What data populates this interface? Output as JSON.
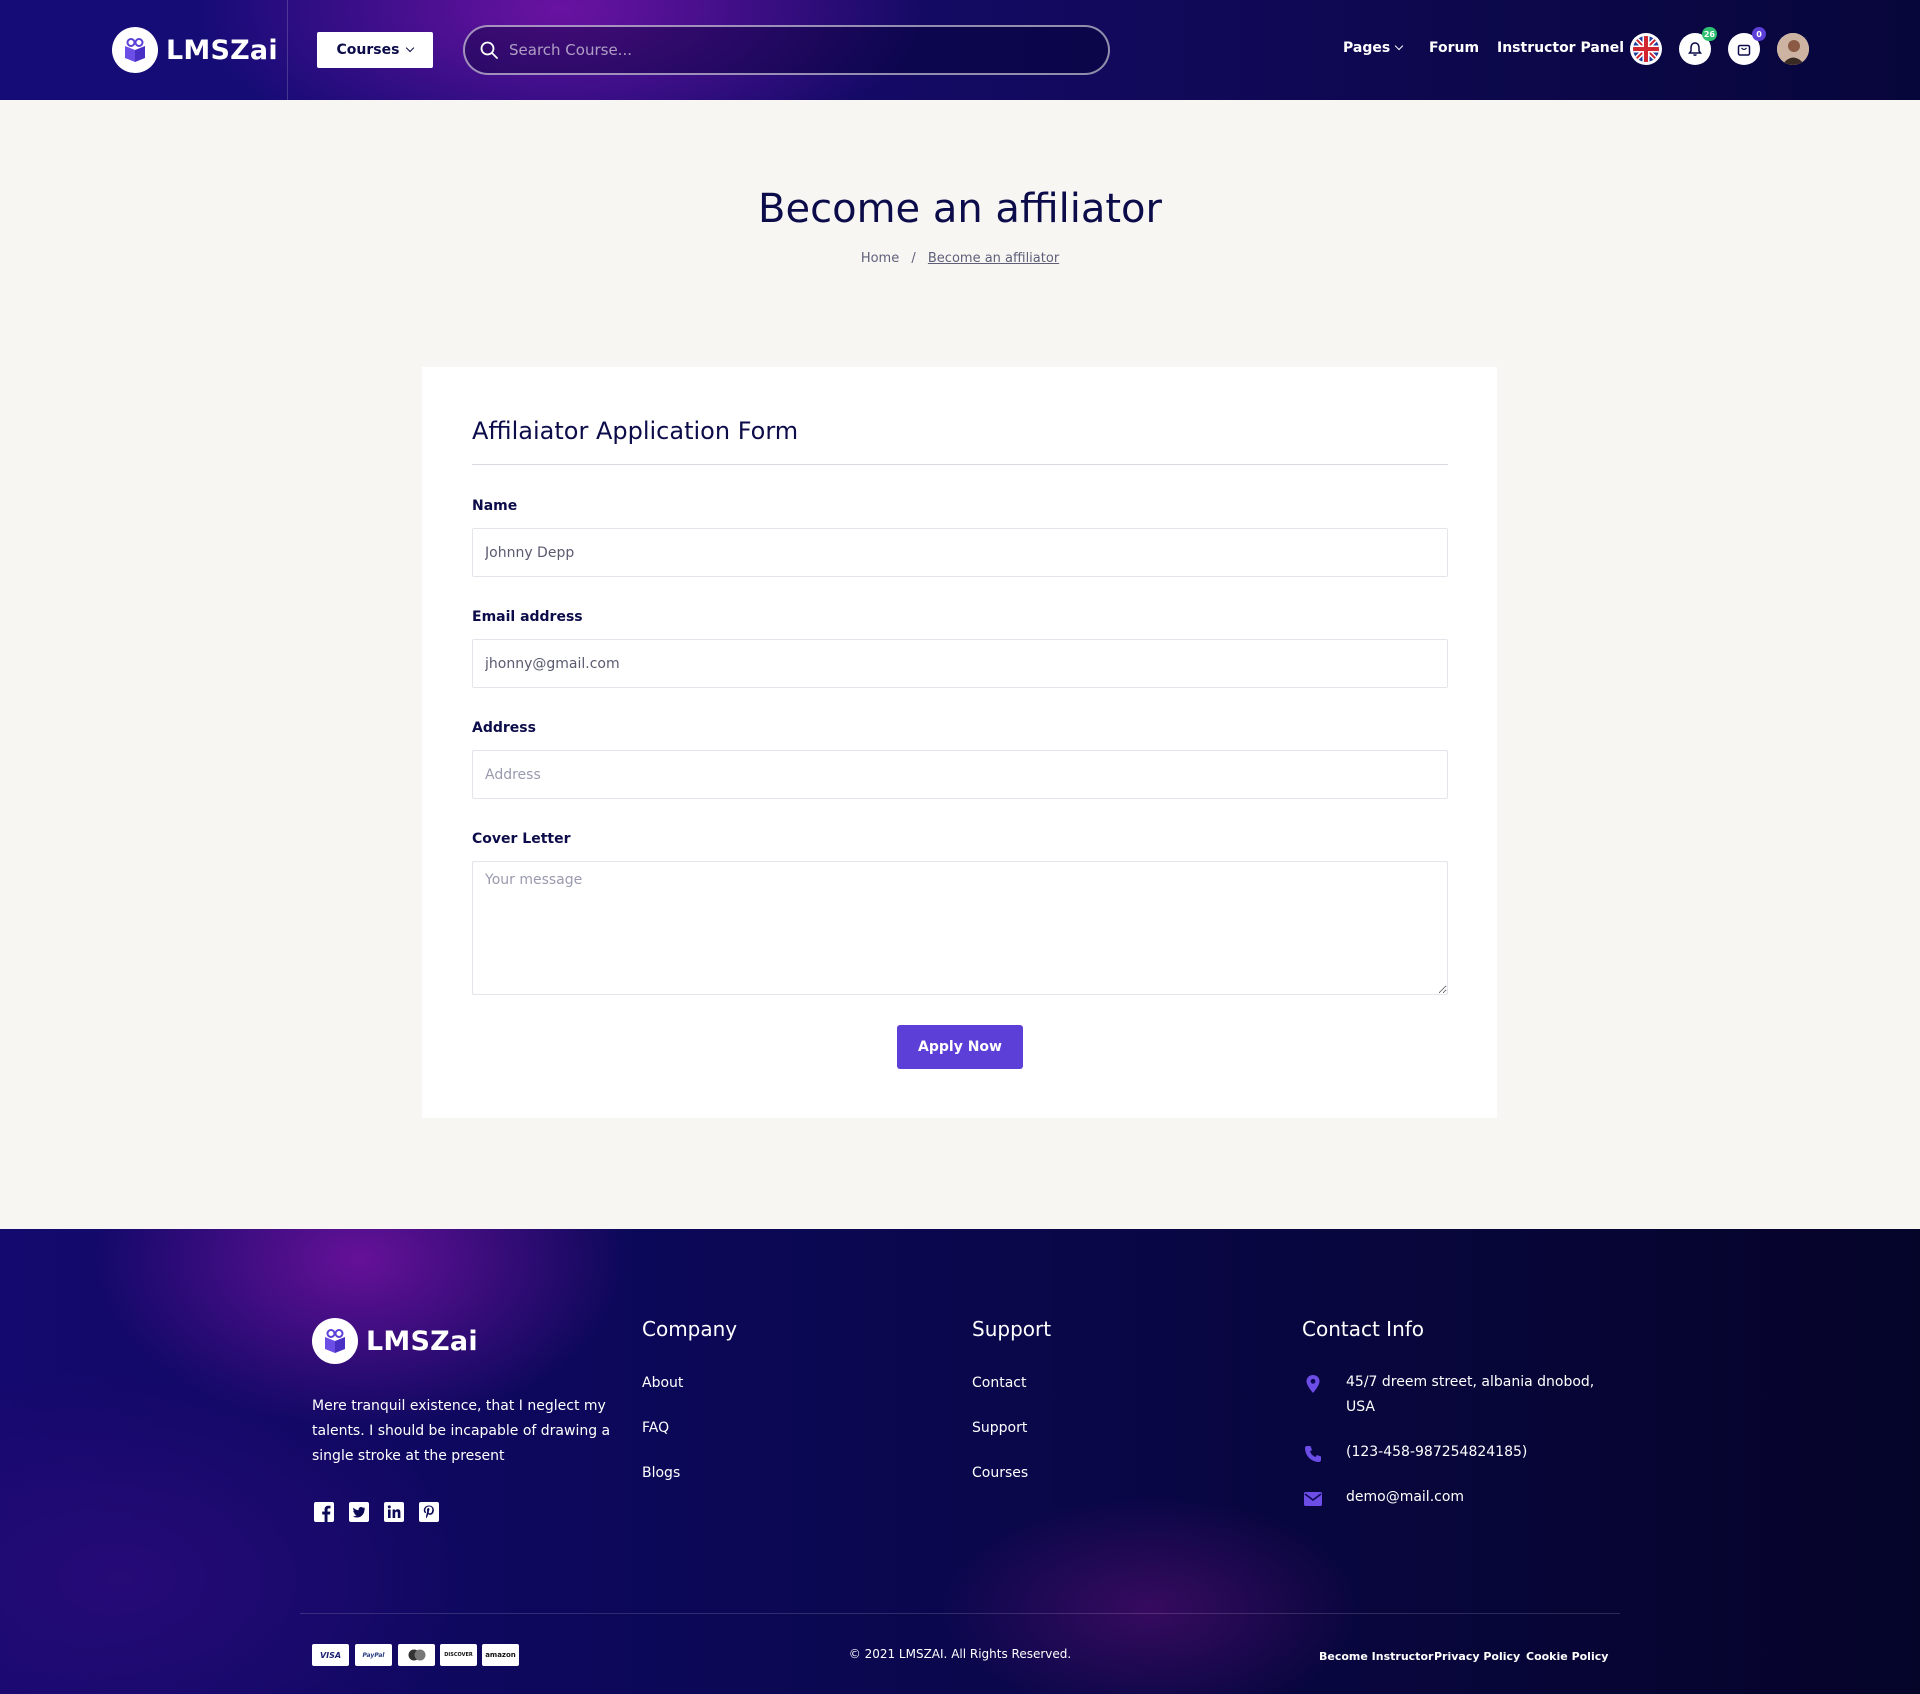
{
  "header": {
    "brand": "LMSZai",
    "courses_label": "Courses",
    "search_placeholder": "Search Course...",
    "nav": {
      "pages": "Pages",
      "forum": "Forum",
      "instructor_panel": "Instructor Panel"
    },
    "notification_count": "26",
    "cart_count": "0",
    "colors": {
      "accent": "#5b3fd6",
      "notification_badge": "#2fbf71"
    }
  },
  "page": {
    "title": "Become an affiliator",
    "breadcrumb": {
      "home": "Home",
      "separator": "/",
      "current": "Become an affiliator"
    }
  },
  "form": {
    "title": "Affilaiator Application Form",
    "name_label": "Name",
    "name_value": "Johnny Depp",
    "email_label": "Email address",
    "email_value": "jhonny@gmail.com",
    "address_label": "Address",
    "address_placeholder": "Address",
    "cover_label": "Cover Letter",
    "cover_placeholder": "Your message",
    "submit_label": "Apply Now"
  },
  "footer": {
    "brand": "LMSZai",
    "description": "Mere tranquil existence, that I neglect my talents. I should be incapable of drawing a single stroke at the present",
    "social": [
      "facebook-icon",
      "twitter-icon",
      "linkedin-icon",
      "pinterest-icon"
    ],
    "company": {
      "title": "Company",
      "links": [
        "About",
        "FAQ",
        "Blogs"
      ]
    },
    "support": {
      "title": "Support",
      "links": [
        "Contact",
        "Support",
        "Courses"
      ]
    },
    "contact": {
      "title": "Contact Info",
      "address": "45/7 dreem street, albania dnobod, USA",
      "phone": "(123-458-987254824185)",
      "email": "demo@mail.com"
    },
    "payments": [
      "VISA",
      "PayPal",
      "MC",
      "DISCOVER",
      "amazon"
    ],
    "copyright": "© 2021 LMSZAI. All Rights Reserved.",
    "bottom_links": [
      "Become Instructor",
      "Privacy Policy",
      "Cookie Policy"
    ]
  }
}
